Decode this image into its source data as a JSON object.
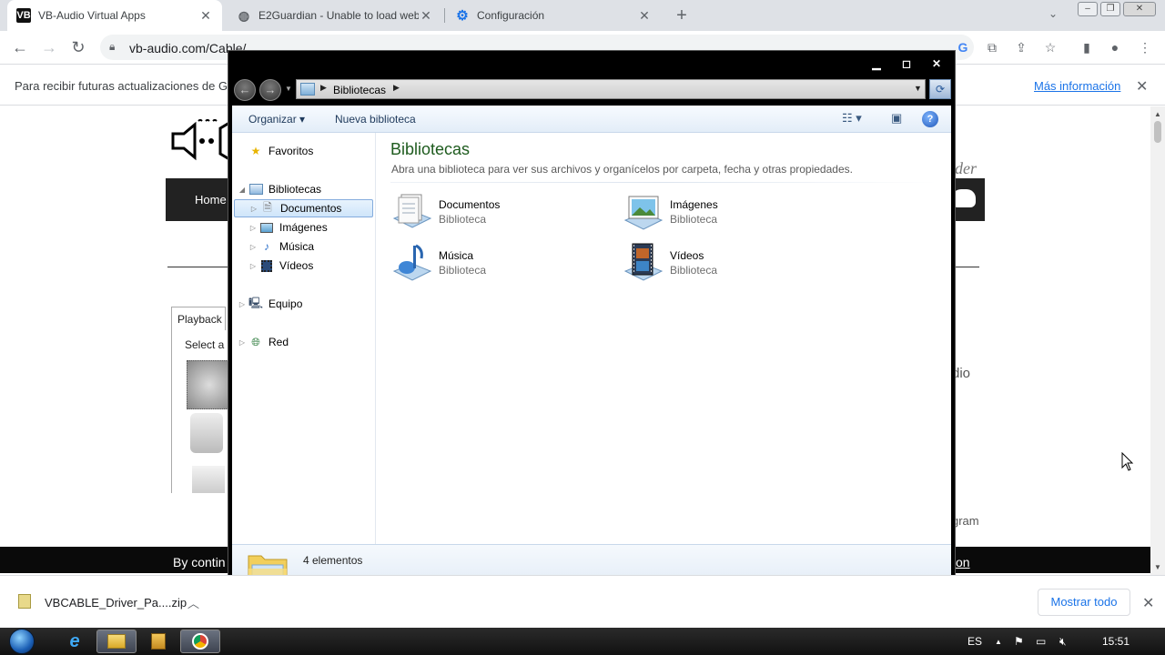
{
  "browser": {
    "tabs": [
      {
        "label": "VB-Audio Virtual Apps",
        "favicon": "VB"
      },
      {
        "label": "E2Guardian - Unable to load web",
        "favicon": "globe-icon"
      },
      {
        "label": "Configuración",
        "favicon": "gear-icon"
      }
    ],
    "url": "vb-audio.com/Cable/",
    "infobar": {
      "message": "Para recibir futuras actualizaciones de Go",
      "more_link": "Más información"
    }
  },
  "page_behind": {
    "nav_home": "Home",
    "playback_tab": "Playback",
    "select_text": "Select a p",
    "frag_right_1": "ider",
    "frag_right_2": "dio",
    "frag_right_3": "gram",
    "cookie_text": "By contin",
    "cookie_link": "on"
  },
  "explorer": {
    "breadcrumb": "Bibliotecas",
    "commands": {
      "organize": "Organizar",
      "new_library": "Nueva biblioteca"
    },
    "nav": {
      "favorites": "Favoritos",
      "libraries": "Bibliotecas",
      "documents": "Documentos",
      "images": "Imágenes",
      "music": "Música",
      "videos": "Vídeos",
      "computer": "Equipo",
      "network": "Red"
    },
    "heading": "Bibliotecas",
    "description": "Abra una biblioteca para ver sus archivos y organícelos por carpeta, fecha y otras propiedades.",
    "libraries": [
      {
        "name": "Documentos",
        "type": "Biblioteca",
        "icon": "documents-library-icon"
      },
      {
        "name": "Imágenes",
        "type": "Biblioteca",
        "icon": "pictures-library-icon"
      },
      {
        "name": "Música",
        "type": "Biblioteca",
        "icon": "music-library-icon"
      },
      {
        "name": "Vídeos",
        "type": "Biblioteca",
        "icon": "videos-library-icon"
      }
    ],
    "status": "4 elementos"
  },
  "downloads": {
    "filename": "VBCABLE_Driver_Pa....zip",
    "show_all": "Mostrar todo"
  },
  "taskbar": {
    "language": "ES",
    "clock": "15:51"
  }
}
